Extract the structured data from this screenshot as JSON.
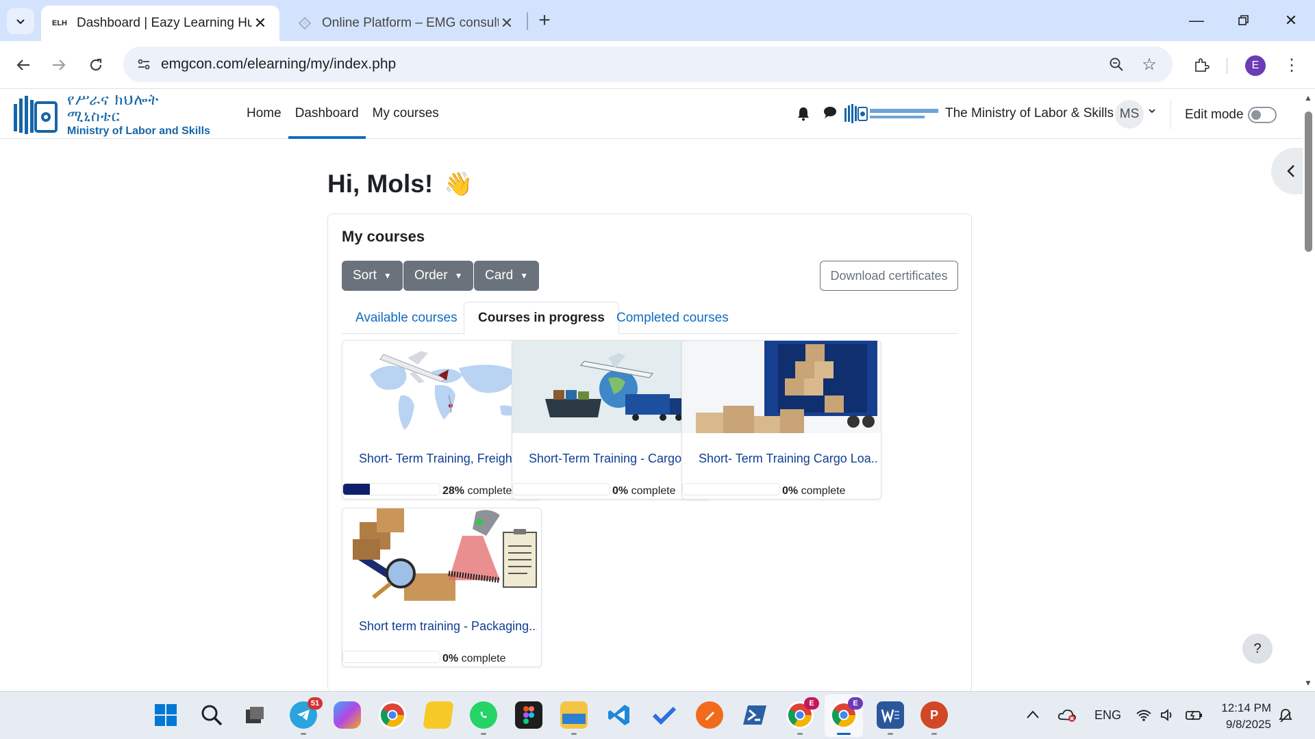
{
  "browser": {
    "tabs": [
      {
        "title": "Dashboard | Eazy Learning Hub",
        "favicon": "ELH"
      },
      {
        "title": "Online Platform – EMG consulti",
        "favicon": "diamond"
      }
    ],
    "url": "emgcon.com/elearning/my/index.php",
    "profile_initial": "E"
  },
  "site": {
    "logo_amharic": "የሥራና ክህሎት ሚኒስቴር",
    "logo_english": "Ministry of Labor and Skills",
    "nav": [
      "Home",
      "Dashboard",
      "My courses"
    ],
    "active_nav": "Dashboard",
    "org_name": "The Ministry of Labor & Skills",
    "user_initials": "MS",
    "edit_mode_label": "Edit mode"
  },
  "page": {
    "greeting": "Hi, Mols!",
    "greeting_emoji": "👋",
    "block_title": "My courses",
    "controls": {
      "sort": "Sort",
      "order": "Order",
      "card": "Card",
      "download": "Download certificates"
    },
    "tabs": [
      "Available courses",
      "Courses in progress",
      "Completed courses"
    ],
    "active_tab": "Courses in progress",
    "courses": [
      {
        "name": "Short- Term Training, Freight Tr...",
        "progress": 28,
        "progress_text": "complete",
        "image": "world-map-airplane"
      },
      {
        "name": "Short-Term Training - Cargo De...",
        "progress": 0,
        "progress_text": "complete",
        "image": "ship-plane-truck-globe"
      },
      {
        "name": "Short- Term Training Cargo Loa...",
        "progress": 0,
        "progress_text": "complete",
        "image": "container-truck-boxes"
      },
      {
        "name": "Short term training - Packaging...",
        "progress": 0,
        "progress_text": "complete",
        "image": "boxes-scanner-clipboard"
      }
    ],
    "help": "?"
  },
  "taskbar": {
    "telegram_badge": "51",
    "chrome_badge_1": "E",
    "chrome_badge_2": "E",
    "lang": "ENG",
    "time": "12:14 PM",
    "date": "9/8/2025"
  },
  "colors": {
    "accent": "#0f6cbf",
    "progress": "#0f1f6b",
    "tabbar": "#d3e3fd",
    "button": "#6a737b"
  }
}
